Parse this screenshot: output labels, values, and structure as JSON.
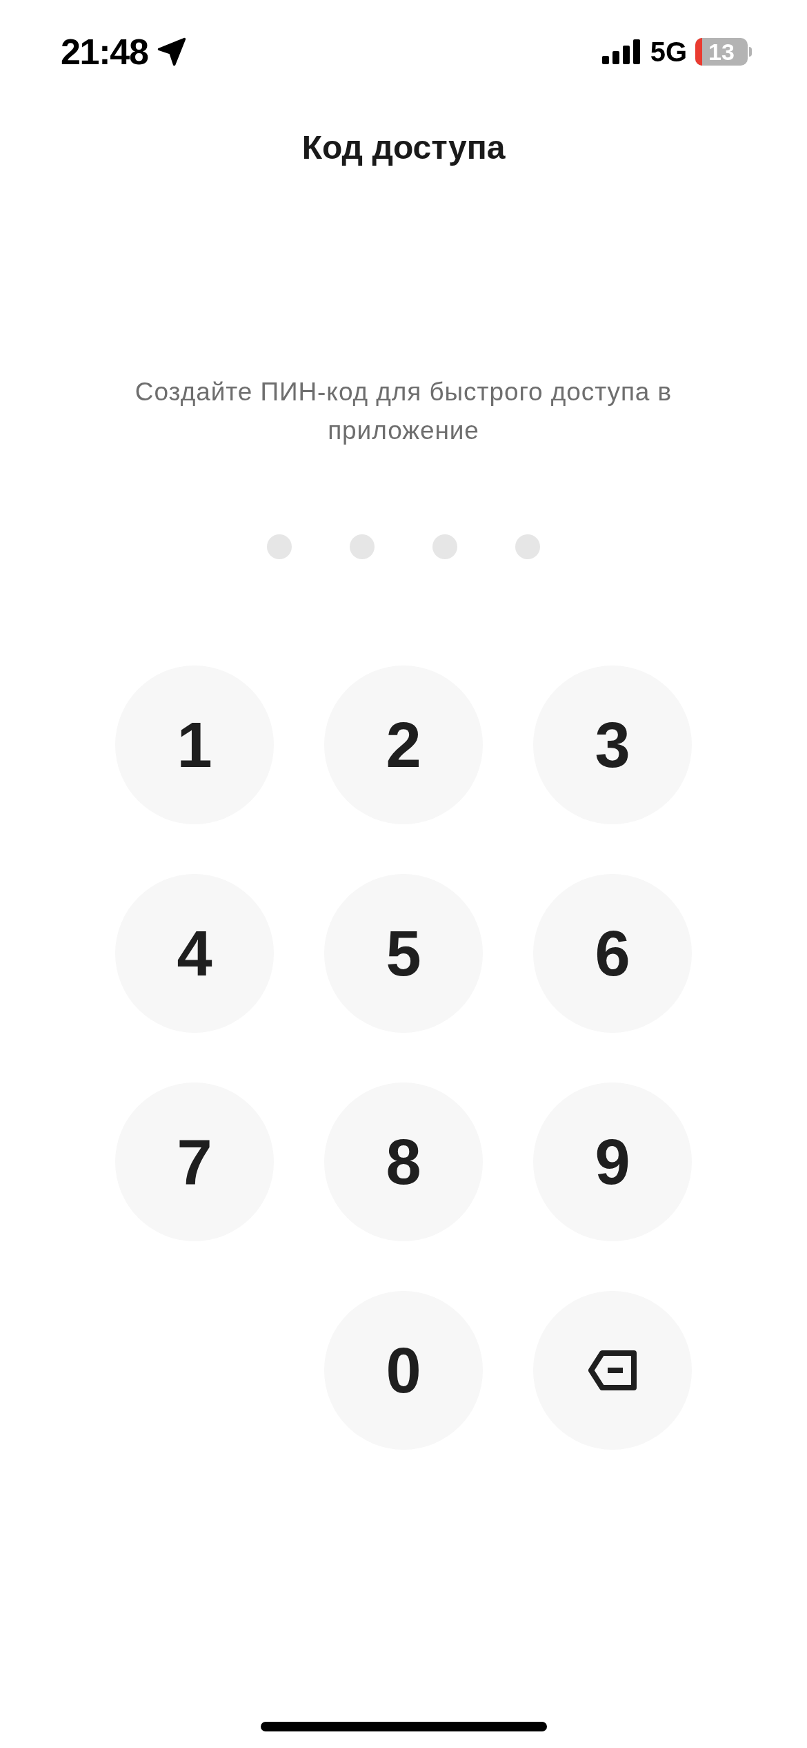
{
  "status_bar": {
    "time": "21:48",
    "network": "5G",
    "battery": "13"
  },
  "title": "Код доступа",
  "prompt": "Создайте ПИН-код для быстрого доступа в приложение",
  "pin_dots": [
    {
      "filled": false
    },
    {
      "filled": false
    },
    {
      "filled": false
    },
    {
      "filled": false
    }
  ],
  "keypad": [
    {
      "kind": "digit",
      "label": "1"
    },
    {
      "kind": "digit",
      "label": "2"
    },
    {
      "kind": "digit",
      "label": "3"
    },
    {
      "kind": "digit",
      "label": "4"
    },
    {
      "kind": "digit",
      "label": "5"
    },
    {
      "kind": "digit",
      "label": "6"
    },
    {
      "kind": "digit",
      "label": "7"
    },
    {
      "kind": "digit",
      "label": "8"
    },
    {
      "kind": "digit",
      "label": "9"
    },
    {
      "kind": "empty"
    },
    {
      "kind": "digit",
      "label": "0"
    },
    {
      "kind": "delete"
    }
  ]
}
